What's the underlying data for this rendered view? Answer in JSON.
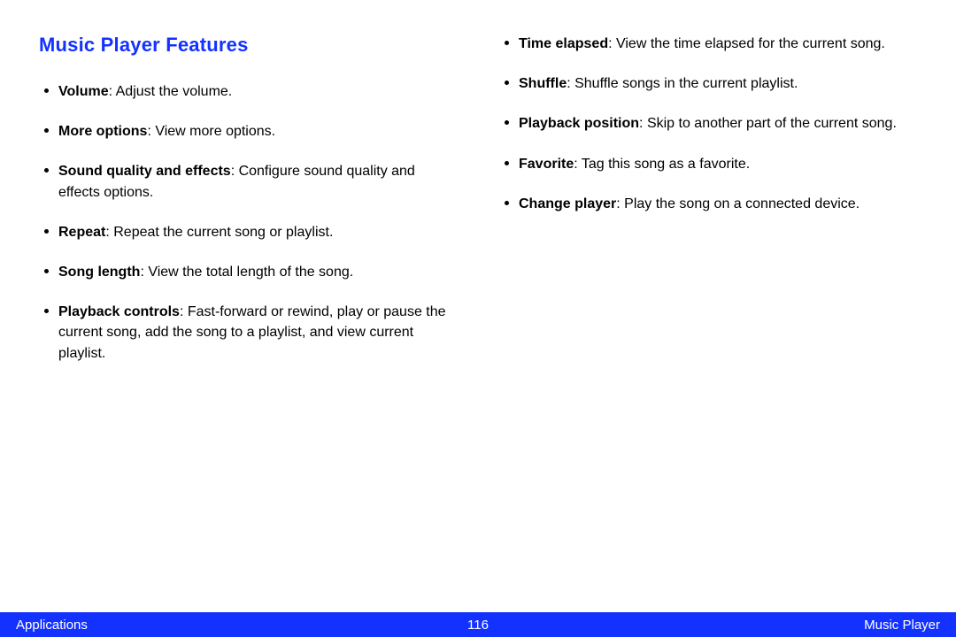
{
  "heading": "Music Player Features",
  "left_items": [
    {
      "term": "Volume",
      "desc": ": Adjust the volume."
    },
    {
      "term": "More options",
      "desc": ": View more options."
    },
    {
      "term": "Sound quality and effects",
      "desc": ": Configure sound quality and effects options."
    },
    {
      "term": "Repeat",
      "desc": ": Repeat the current song or playlist."
    },
    {
      "term": "Song length",
      "desc": ": View the total length of the song."
    },
    {
      "term": "Playback controls",
      "desc": ": Fast-forward or rewind, play or pause the current song, add the song to a playlist, and view current playlist."
    }
  ],
  "right_items": [
    {
      "term": "Time elapsed",
      "desc": ": View the time elapsed for the current song."
    },
    {
      "term": "Shuffle",
      "desc": ": Shuffle songs in the current playlist."
    },
    {
      "term": "Playback position",
      "desc": ": Skip to another part of the current song."
    },
    {
      "term": "Favorite",
      "desc": ": Tag this song as a favorite."
    },
    {
      "term": "Change player",
      "desc": ": Play the song on a connected device."
    }
  ],
  "footer": {
    "left": "Applications",
    "center": "116",
    "right": "Music Player"
  }
}
